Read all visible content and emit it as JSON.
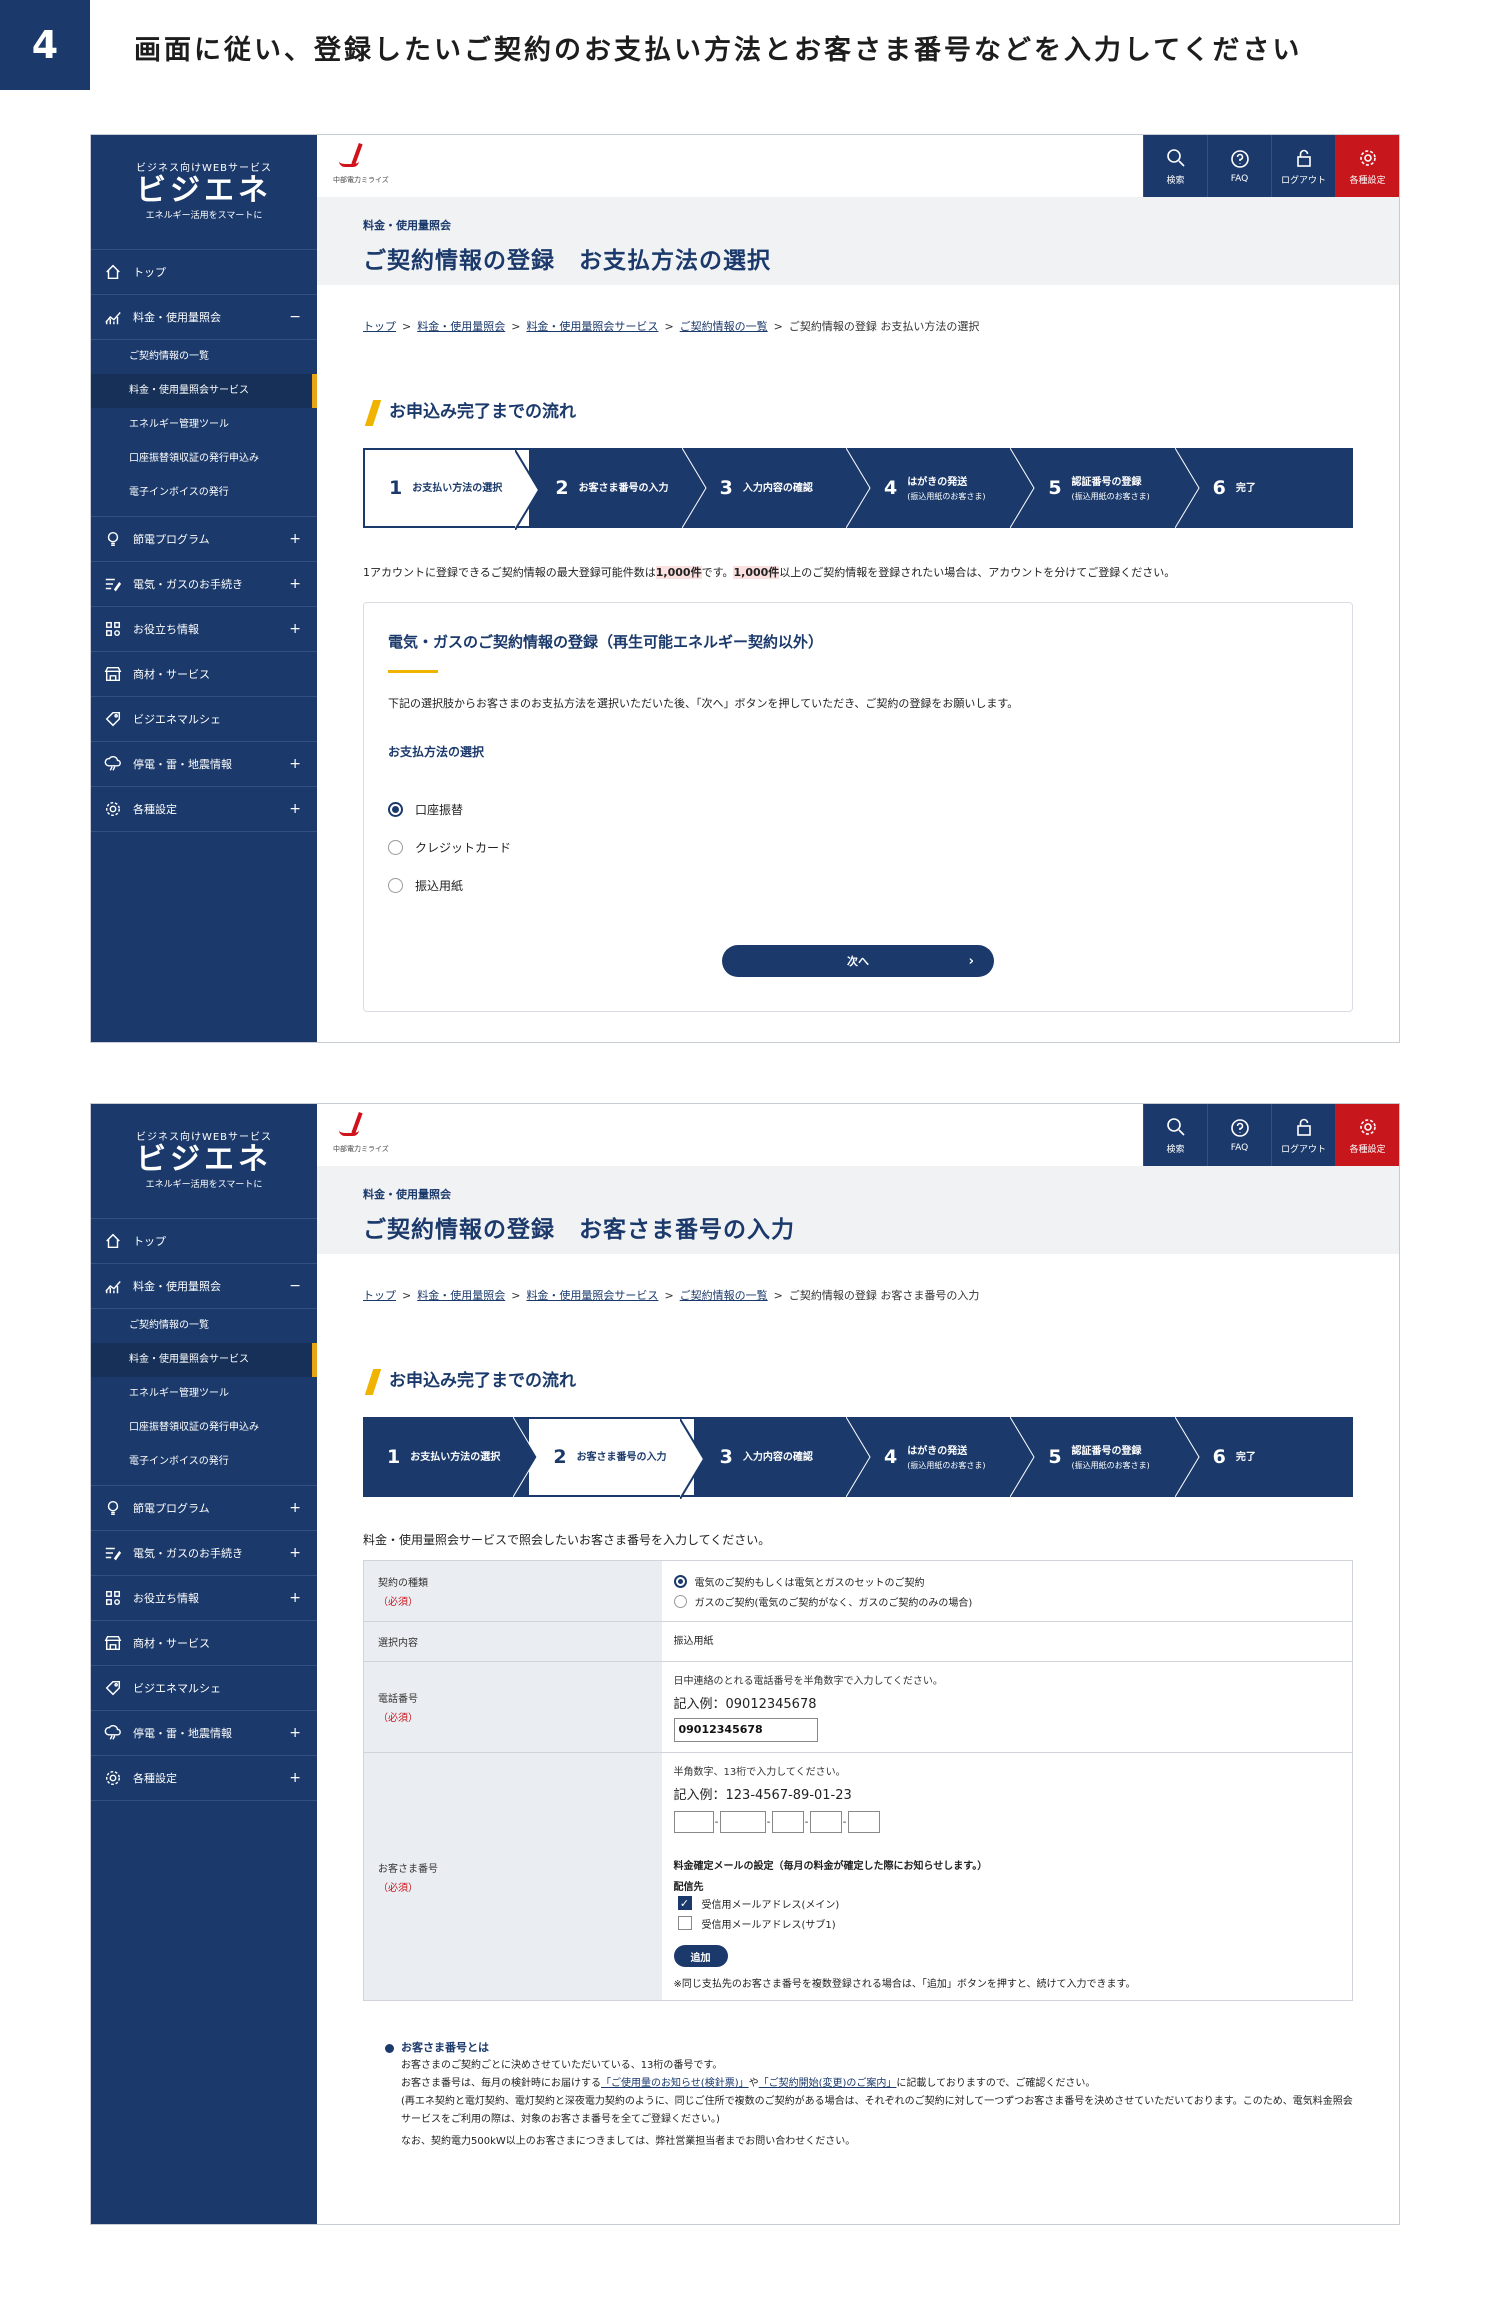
{
  "step": {
    "number": "4",
    "text": "画面に従い、登録したいご契約のお支払い方法とお客さま番号などを入力してください"
  },
  "brand": {
    "sub": "ビジネス向けWEBサービス",
    "logo": "ビジエネ",
    "tagline": "エネルギー活用をスマートに",
    "corp": "中部電力ミライズ"
  },
  "topbar": {
    "search": "検索",
    "faq": "FAQ",
    "logout": "ログアウト",
    "settings": "各種設定"
  },
  "sidebar": {
    "top": "トップ",
    "rates": "料金・使用量照会",
    "rates_toggle": "−",
    "sub": [
      "ご契約情報の一覧",
      "料金・使用量照会サービス",
      "エネルギー管理ツール",
      "口座振替領収証の発行申込み",
      "電子インボイスの発行"
    ],
    "items": [
      {
        "label": "節電プログラム",
        "pm": "+"
      },
      {
        "label": "電気・ガスのお手続き",
        "pm": "+"
      },
      {
        "label": "お役立ち情報",
        "pm": "+"
      },
      {
        "label": "商材・サービス",
        "pm": ""
      },
      {
        "label": "ビジエネマルシェ",
        "pm": ""
      },
      {
        "label": "停電・雷・地震情報",
        "pm": "+"
      },
      {
        "label": "各種設定",
        "pm": "+"
      }
    ]
  },
  "flow": {
    "title": "お申込み完了までの流れ",
    "steps": [
      {
        "n": "1",
        "label": "お支払い方法の選択",
        "note": ""
      },
      {
        "n": "2",
        "label": "お客さま番号の入力",
        "note": ""
      },
      {
        "n": "3",
        "label": "入力内容の確認",
        "note": ""
      },
      {
        "n": "4",
        "label": "はがきの発送",
        "note": "(振込用紙のお客さま)"
      },
      {
        "n": "5",
        "label": "認証番号の登録",
        "note": "(振込用紙のお客さま)"
      },
      {
        "n": "6",
        "label": "完了",
        "note": ""
      }
    ]
  },
  "screen1": {
    "category": "料金・使用量照会",
    "title": "ご契約情報の登録　お支払方法の選択",
    "crumbs": [
      "トップ",
      "料金・使用量照会",
      "料金・使用量照会サービス",
      "ご契約情報の一覧"
    ],
    "crumb_current": "ご契約情報の登録 お支払い方法の選択",
    "notice_a": "1アカウントに登録できるご契約情報の最大登録可能件数は",
    "notice_hl1": "1,000件",
    "notice_b": "です。",
    "notice_hl2": "1,000件",
    "notice_c": "以上のご契約情報を登録されたい場合は、アカウントを分けてご登録ください。",
    "card_title": "電気・ガスのご契約情報の登録（再生可能エネルギー契約以外）",
    "card_desc": "下記の選択肢からお客さまのお支払方法を選択いただいた後、「次へ」ボタンを押していただき、ご契約の登録をお願いします。",
    "pay_label": "お支払方法の選択",
    "options": [
      "口座振替",
      "クレジットカード",
      "振込用紙"
    ],
    "next": "次へ"
  },
  "screen2": {
    "category": "料金・使用量照会",
    "title": "ご契約情報の登録　お客さま番号の入力",
    "crumb_current": "ご契約情報の登録 お客さま番号の入力",
    "lead": "料金・使用量照会サービスで照会したいお客さま番号を入力してください。",
    "required": "（必須）",
    "contract_type_label": "契約の種類",
    "contract_opts": [
      "電気のご契約もしくは電気とガスのセットのご契約",
      "ガスのご契約(電気のご契約がなく、ガスのご契約のみの場合)"
    ],
    "selected_label": "選択内容",
    "selected_value": "振込用紙",
    "phone_label": "電話番号",
    "phone_hint": "日中連絡のとれる電話番号を半角数字で入力してください。",
    "phone_example": "記入例：09012345678",
    "phone_value": "09012345678",
    "cust_label": "お客さま番号",
    "cust_hint": "半角数字、13桁で入力してください。",
    "cust_example": "記入例：123-4567-89-01-23",
    "mail_title": "料金確定メールの設定（毎月の料金が確定した際にお知らせします。）",
    "mail_to": "配信先",
    "mail_opts": [
      "受信用メールアドレス(メイン)",
      "受信用メールアドレス(サブ1)"
    ],
    "add": "追加",
    "add_note": "※同じ支払先のお客さま番号を複数登録される場合は、「追加」ボタンを押すと、続けて入力できます。",
    "about_title": "お客さま番号とは",
    "about_1": "お客さまのご契約ごとに決めさせていただいている、13桁の番号です。",
    "about_2a": "お客さま番号は、毎月の検針時にお届けする",
    "about_2b": "「ご使用量のお知らせ(検針票)」",
    "about_2c": "や",
    "about_2d": "「ご契約開始(変更)のご案内」",
    "about_2e": "に記載しておりますので、ご確認ください。",
    "about_3": "(再エネ契約と電灯契約、電灯契約と深夜電力契約のように、同じご住所で複数のご契約がある場合は、それぞれのご契約に対して一つずつお客さま番号を決めさせていただいております。このため、電気料金照会サービスをご利用の際は、対象のお客さま番号を全てご登録ください。)",
    "about_4": "なお、契約電力500kW以上のお客さまにつきましては、弊社営業担当者までお問い合わせください。"
  },
  "colors": {
    "navy": "#1b3a6b",
    "accent": "#f0b400",
    "red": "#c8161d"
  }
}
